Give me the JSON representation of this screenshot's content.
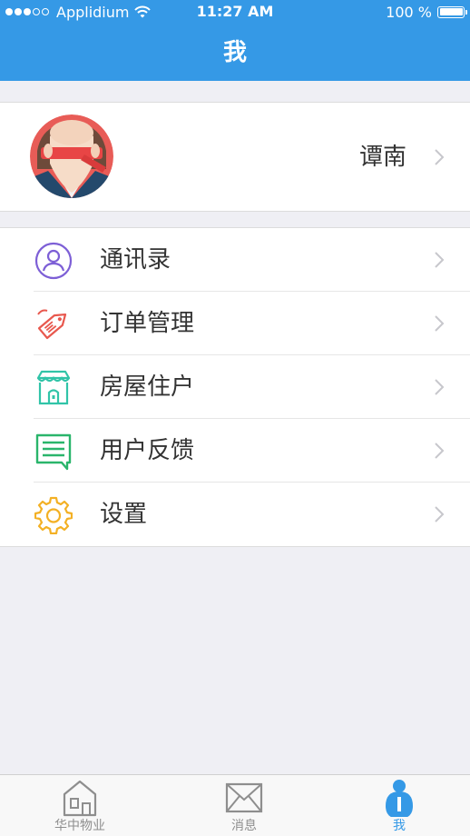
{
  "status_bar": {
    "carrier": "Applidium",
    "time": "11:27 AM",
    "battery": "100 %"
  },
  "nav": {
    "title": "我"
  },
  "profile": {
    "name": "谭南"
  },
  "menu": [
    {
      "label": "通讯录",
      "icon": "contacts-icon",
      "color": "#7d5fd6"
    },
    {
      "label": "订单管理",
      "icon": "tag-icon",
      "color": "#e8584e"
    },
    {
      "label": "房屋住户",
      "icon": "store-icon",
      "color": "#31c4a8"
    },
    {
      "label": "用户反馈",
      "icon": "feedback-icon",
      "color": "#2ab56b"
    },
    {
      "label": "设置",
      "icon": "gear-icon",
      "color": "#f3b024"
    }
  ],
  "tabs": [
    {
      "label": "华中物业",
      "icon": "house-icon",
      "active": false
    },
    {
      "label": "消息",
      "icon": "mail-icon",
      "active": false
    },
    {
      "label": "我",
      "icon": "person-icon",
      "active": true
    }
  ],
  "colors": {
    "primary": "#3599e6",
    "background": "#efeff4",
    "text": "#333333"
  }
}
